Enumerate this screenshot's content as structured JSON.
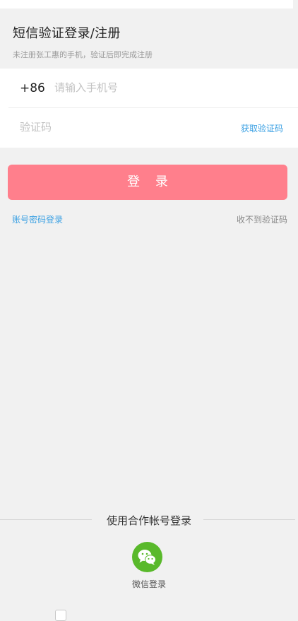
{
  "header": {
    "title": "短信验证登录/注册",
    "subtitle": "未注册张工惠的手机，验证后即完成注册"
  },
  "form": {
    "country_code": "+86",
    "phone_placeholder": "请输入手机号",
    "code_placeholder": "验证码",
    "get_code_label": "获取验证码"
  },
  "actions": {
    "login_label": "登 录",
    "password_login_label": "账号密码登录",
    "no_code_label": "收不到验证码"
  },
  "partner": {
    "title": "使用合作帐号登录",
    "wechat_label": "微信登录",
    "wechat_icon": "wechat-icon"
  },
  "colors": {
    "accent": "#ff7f8c",
    "link": "#3aa0e3",
    "wechat": "#59b92b",
    "background": "#f1f1f1"
  }
}
